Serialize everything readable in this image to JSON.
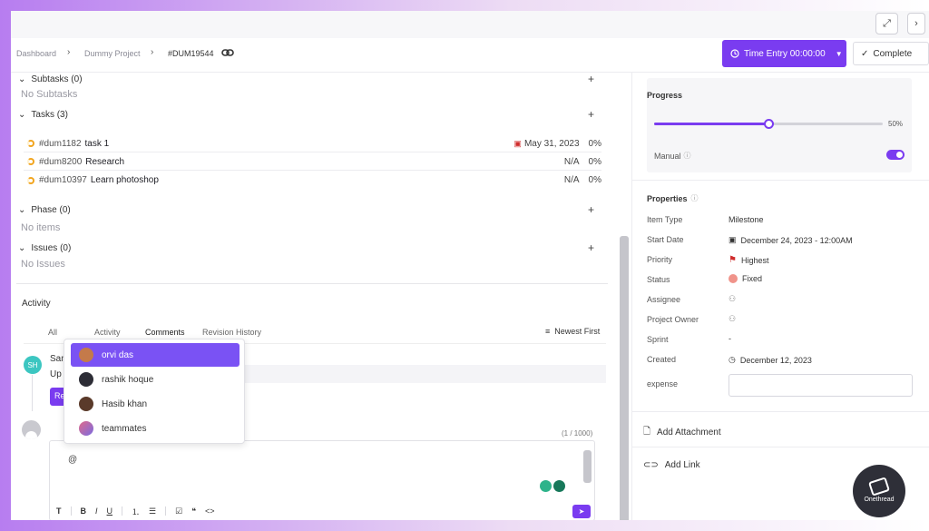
{
  "window": {
    "expand_icon": "expand-icon",
    "more_icon": "chevron-right-icon"
  },
  "breadcrumb": {
    "items": [
      "Dashboard",
      "Dummy Project",
      "#DUM19544"
    ],
    "link_icon": "link-icon"
  },
  "header": {
    "time_entry_label": "Time Entry 00:00:00",
    "complete_label": "Complete"
  },
  "sections": {
    "subtasks": {
      "title": "Subtasks (0)",
      "empty": "No Subtasks"
    },
    "tasks": {
      "title": "Tasks (3)"
    },
    "phase": {
      "title": "Phase (0)",
      "empty": "No items"
    },
    "issues": {
      "title": "Issues (0)",
      "empty": "No Issues"
    }
  },
  "tasks": [
    {
      "id": "#dum1182",
      "name": "task 1",
      "date": "May 31, 2023",
      "progress": "0%"
    },
    {
      "id": "#dum8200",
      "name": "Research",
      "date": "N/A",
      "progress": "0%"
    },
    {
      "id": "#dum10397",
      "name": "Learn photoshop",
      "date": "N/A",
      "progress": "0%"
    }
  ],
  "activity": {
    "title": "Activity",
    "tabs": [
      "All",
      "Activity",
      "Comments",
      "Revision History"
    ],
    "active_tab": "Comments",
    "sort_label": "Newest First",
    "comment_avatar_initials": "SH",
    "comment_author_stub": "San",
    "comment_text_stub": "Up",
    "reply_stub": "Re",
    "counter": "(1 / 1000)",
    "editor_text": "@"
  },
  "mentions": [
    {
      "name": "orvi das",
      "color": "#c47a4a",
      "active": true
    },
    {
      "name": "rashik hoque",
      "color": "#2d2d36",
      "active": false
    },
    {
      "name": "Hasib khan",
      "color": "#5a3a2a",
      "active": false
    },
    {
      "name": "teammates",
      "color": "#d0607a",
      "active": false
    }
  ],
  "progress": {
    "title": "Progress",
    "value": 50,
    "label": "50%",
    "manual_label": "Manual",
    "manual_on": true
  },
  "properties": {
    "title": "Properties",
    "rows": [
      {
        "label": "Item Type",
        "value": "Milestone"
      },
      {
        "label": "Start Date",
        "value": "December 24, 2023 - 12:00AM"
      },
      {
        "label": "Priority",
        "value": "Highest"
      },
      {
        "label": "Status",
        "value": "Fixed"
      },
      {
        "label": "Assignee",
        "value": ""
      },
      {
        "label": "Project Owner",
        "value": ""
      },
      {
        "label": "Sprint",
        "value": "-"
      },
      {
        "label": "Created",
        "value": "December 12, 2023"
      },
      {
        "label": "expense",
        "value": ""
      }
    ]
  },
  "links": {
    "attachment": "Add Attachment",
    "link": "Add Link"
  },
  "brand": {
    "name": "Onethread"
  },
  "colors": {
    "accent": "#7a3cf0",
    "priority_flag": "#d02d2d",
    "status_fixed": "#f0938a",
    "task_pending": "#f2a51f",
    "sh_avatar": "#3cc6c1"
  }
}
